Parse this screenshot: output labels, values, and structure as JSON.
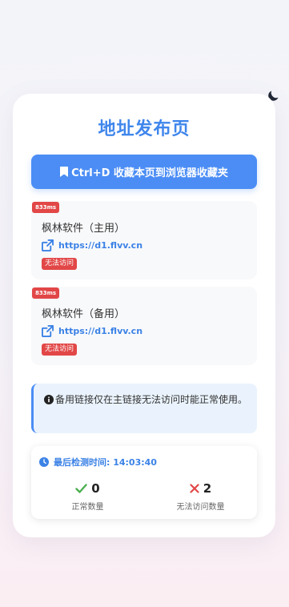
{
  "page": {
    "title": "地址发布页",
    "bookmark_button_label": "Ctrl+D 收藏本页到浏览器收藏夹"
  },
  "links": [
    {
      "latency": "833ms",
      "name": "枫林软件（主用）",
      "url": "https://d1.flvv.cn",
      "status": "无法访问"
    },
    {
      "latency": "833ms",
      "name": "枫林软件（备用）",
      "url": "https://d1.flvv.cn",
      "status": "无法访问"
    }
  ],
  "notice": {
    "text": "备用链接仅在主链接无法访问时能正常使用。"
  },
  "stats": {
    "last_check_label": "最后检测时间: 14:03:40",
    "ok_count": "0",
    "ok_label": "正常数量",
    "fail_count": "2",
    "fail_label": "无法访问数量"
  },
  "colors": {
    "accent": "#4b8df5",
    "error": "#e24747",
    "success": "#4caf50"
  },
  "icons": {
    "theme": "moon-icon",
    "bookmark": "bookmark-icon",
    "link": "external-link-icon",
    "info": "info-circle-icon",
    "clock": "clock-icon",
    "ok": "check-icon",
    "fail": "cross-icon"
  }
}
